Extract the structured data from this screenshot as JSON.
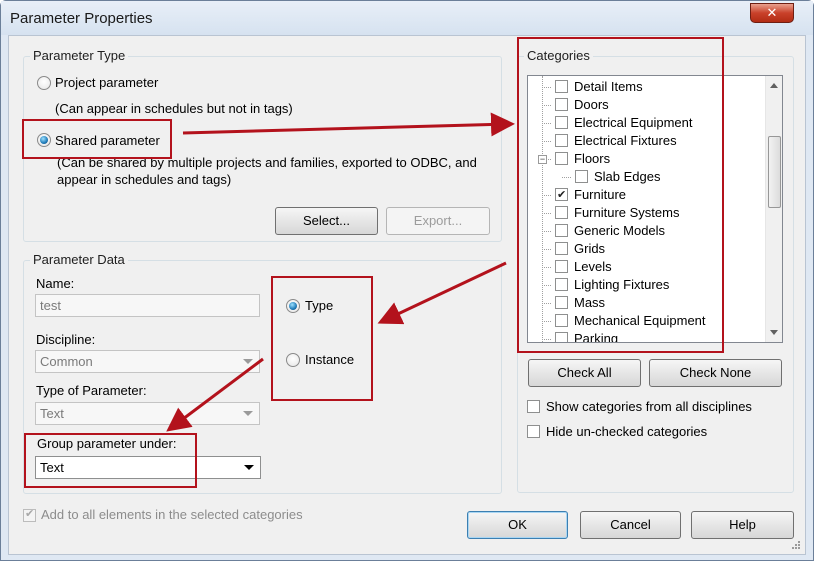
{
  "window": {
    "title": "Parameter Properties",
    "close_glyph": "✕"
  },
  "parameter_type": {
    "group_title": "Parameter Type",
    "project_label": "Project parameter",
    "project_desc": "(Can appear in schedules but not in tags)",
    "shared_label": "Shared parameter",
    "shared_desc_line1": "(Can be shared by multiple projects and families, exported to ODBC, and",
    "shared_desc_line2": "appear in schedules and tags)",
    "selected": "shared",
    "select_button": "Select...",
    "export_button": "Export..."
  },
  "parameter_data": {
    "group_title": "Parameter Data",
    "name_label": "Name:",
    "name_value": "test",
    "discipline_label": "Discipline:",
    "discipline_value": "Common",
    "type_of_parameter_label": "Type of Parameter:",
    "type_of_parameter_value": "Text",
    "type_radio_label": "Type",
    "instance_radio_label": "Instance",
    "selected_scope": "type",
    "group_under_label": "Group parameter under:",
    "group_under_value": "Text"
  },
  "categories": {
    "group_title": "Categories",
    "items": [
      {
        "label": "Detail Items",
        "checked": false,
        "level": 0
      },
      {
        "label": "Doors",
        "checked": false,
        "level": 0
      },
      {
        "label": "Electrical Equipment",
        "checked": false,
        "level": 0
      },
      {
        "label": "Electrical Fixtures",
        "checked": false,
        "level": 0
      },
      {
        "label": "Floors",
        "checked": false,
        "level": 0,
        "expander": "−"
      },
      {
        "label": "Slab Edges",
        "checked": false,
        "level": 1
      },
      {
        "label": "Furniture",
        "checked": true,
        "level": 0
      },
      {
        "label": "Furniture Systems",
        "checked": false,
        "level": 0
      },
      {
        "label": "Generic Models",
        "checked": false,
        "level": 0
      },
      {
        "label": "Grids",
        "checked": false,
        "level": 0
      },
      {
        "label": "Levels",
        "checked": false,
        "level": 0
      },
      {
        "label": "Lighting Fixtures",
        "checked": false,
        "level": 0
      },
      {
        "label": "Mass",
        "checked": false,
        "level": 0
      },
      {
        "label": "Mechanical Equipment",
        "checked": false,
        "level": 0
      },
      {
        "label": "Parking",
        "checked": false,
        "level": 0
      }
    ],
    "check_all_button": "Check All",
    "check_none_button": "Check None",
    "show_all_disciplines_label": "Show categories from all disciplines",
    "show_all_disciplines_checked": false,
    "hide_unchecked_label": "Hide un-checked categories",
    "hide_unchecked_checked": false
  },
  "footer": {
    "add_to_all_label": "Add to all elements in the selected categories",
    "add_to_all_checked": true,
    "ok_button": "OK",
    "cancel_button": "Cancel",
    "help_button": "Help"
  },
  "colors": {
    "annotation_red": "#b3121c",
    "window_frame": "#dfe8f3",
    "dialog_face": "#f0f0f0"
  }
}
